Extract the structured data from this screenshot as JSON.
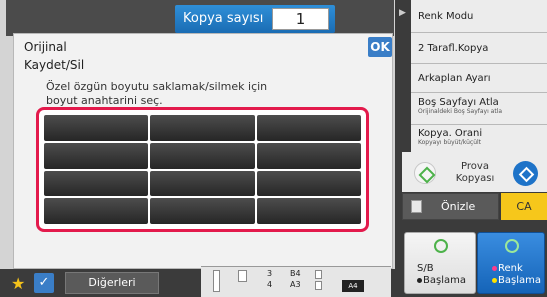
{
  "header": {
    "copy_count_label": "Kopya sayısı",
    "copy_count_value": "1"
  },
  "dialog": {
    "title": "Orijinal",
    "subtitle": "Kaydet/Sil",
    "ok_label": "OK",
    "instruction": "Özel özgün boyutu saklamak/silmek için boyut anahtarini seç.",
    "size_keys": [
      "",
      "",
      "",
      "",
      "",
      "",
      "",
      "",
      "",
      "",
      "",
      ""
    ]
  },
  "right_menu": [
    {
      "label": "Renk Modu",
      "sub": ""
    },
    {
      "label": "2 Tarafl.Kopya",
      "sub": ""
    },
    {
      "label": "Arkaplan Ayarı",
      "sub": ""
    },
    {
      "label": "Boş Sayfayı Atla",
      "sub": "Orijinaldeki Boş Sayfayı atla"
    },
    {
      "label": "Kopya. Orani",
      "sub": "Kopyayı büyüt/küçült"
    }
  ],
  "actions": {
    "prova_label": "Prova Kopyası",
    "preview_label": "Önizle",
    "ca_label": "CA",
    "bw_start_label_1": "S/B",
    "bw_start_label_2": "Başlama",
    "color_start_label_1": "Renk",
    "color_start_label_2": "Başlama"
  },
  "bottom": {
    "others_label": "Diğerleri",
    "tray_rows": [
      "3",
      "4"
    ],
    "tray_sizes": [
      "B4",
      "A3"
    ],
    "current_paper": "A4"
  },
  "colors": {
    "accent_blue": "#1e73c8",
    "highlight_red": "#e31a4c",
    "ca_yellow": "#f6c71b",
    "start_green": "#4db24a"
  }
}
